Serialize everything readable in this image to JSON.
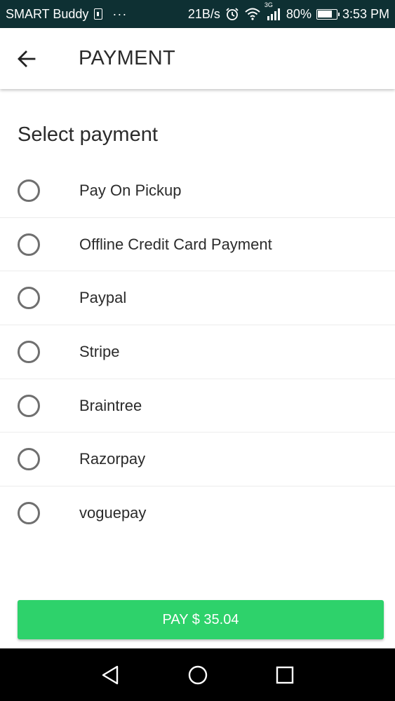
{
  "status_bar": {
    "carrier": "SMART Buddy",
    "dots": "···",
    "speed": "21B/s",
    "network": "3G",
    "battery_percent": "80%",
    "battery_level": 0.8,
    "time": "3:53 PM"
  },
  "app_bar": {
    "title": "PAYMENT"
  },
  "section": {
    "title": "Select payment"
  },
  "payment_options": [
    {
      "label": "Pay On Pickup"
    },
    {
      "label": "Offline Credit Card Payment"
    },
    {
      "label": "Paypal"
    },
    {
      "label": "Stripe"
    },
    {
      "label": "Braintree"
    },
    {
      "label": "Razorpay"
    },
    {
      "label": "voguepay"
    }
  ],
  "pay_button": {
    "label": "PAY $ 35.04"
  },
  "colors": {
    "status_bar": "#0e3033",
    "pay_button": "#2ed26b",
    "radio_border": "#6f6f6f"
  }
}
